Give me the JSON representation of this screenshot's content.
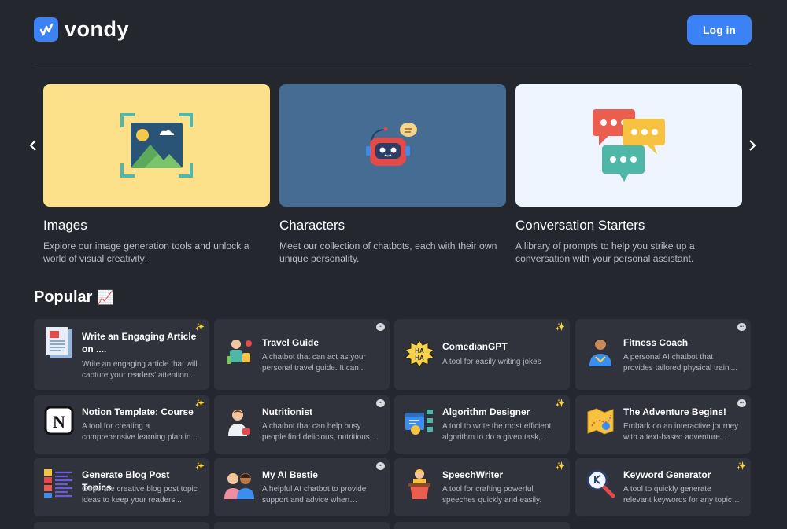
{
  "brand": {
    "name": "vondy",
    "accent": "#3b82f6"
  },
  "header": {
    "login_label": "Log in"
  },
  "categories": [
    {
      "title": "Images",
      "description": "Explore our image generation tools and unlock a world of visual creativity!",
      "bg": "#fce08a"
    },
    {
      "title": "Characters",
      "description": "Meet our collection of chatbots, each with their own unique personality.",
      "bg": "#456d94"
    },
    {
      "title": "Conversation Starters",
      "description": "A library of prompts to help you strike up a conversation with your personal assistant.",
      "bg": "#eef5ff"
    }
  ],
  "popular": {
    "title": "Popular",
    "emoji": "📈",
    "items": [
      {
        "title": "Write an Engaging Article on ....",
        "description": "Write an engaging article that will capture your readers' attention...",
        "badge": "tool",
        "icon": "document-icon"
      },
      {
        "title": "Travel Guide",
        "description": "A chatbot that can act as your personal travel guide. It can...",
        "badge": "chat",
        "icon": "traveler-icon"
      },
      {
        "title": "ComedianGPT",
        "description": "A tool for easily writing jokes",
        "badge": "tool",
        "icon": "haha-icon"
      },
      {
        "title": "Fitness Coach",
        "description": "A personal AI chatbot that provides tailored physical traini...",
        "badge": "chat",
        "icon": "coach-icon"
      },
      {
        "title": "Notion Template: Course",
        "description": "A tool for creating a comprehensive learning plan in...",
        "badge": "tool",
        "icon": "notion-icon"
      },
      {
        "title": "Nutritionist",
        "description": "A chatbot that can help busy people find delicious, nutritious,...",
        "badge": "chat",
        "icon": "nutritionist-icon"
      },
      {
        "title": "Algorithm Designer",
        "description": "A tool to write the most efficient algorithm to do a given task,...",
        "badge": "tool",
        "icon": "algorithm-icon"
      },
      {
        "title": "The Adventure Begins!",
        "description": "Embark on an interactive journey with a text-based adventure...",
        "badge": "chat",
        "icon": "map-icon"
      },
      {
        "title": "Generate Blog Post Topics",
        "description": "Generate creative blog post topic ideas to keep your readers...",
        "badge": "tool",
        "icon": "list-icon"
      },
      {
        "title": "My AI Bestie",
        "description": "A helpful AI chatbot to provide support and advice when needed.",
        "badge": "chat",
        "icon": "friends-icon"
      },
      {
        "title": "SpeechWriter",
        "description": "A tool for crafting powerful speeches quickly and easily.",
        "badge": "tool",
        "icon": "speaker-icon"
      },
      {
        "title": "Keyword Generator",
        "description": "A tool to quickly generate relevant keywords for any topic ...",
        "badge": "tool",
        "icon": "keyword-search-icon"
      }
    ]
  }
}
